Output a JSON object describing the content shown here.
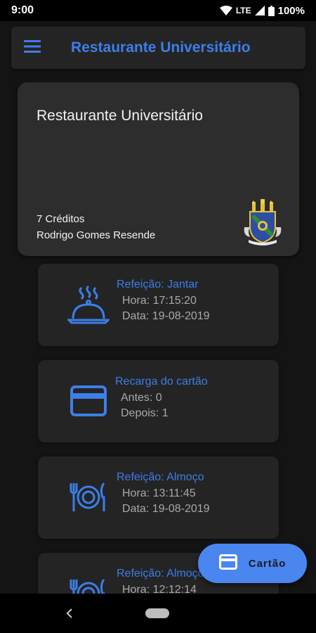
{
  "status": {
    "time": "9:00",
    "network": "LTE",
    "battery": "100%"
  },
  "appbar": {
    "title": "Restaurante Universitário",
    "menu_icon": "menu-icon"
  },
  "card": {
    "title": "Restaurante Universitário",
    "credits": "7 Créditos",
    "holder": "Rodrigo Gomes Resende",
    "crest_icon": "university-crest-icon"
  },
  "transactions": [
    {
      "icon": "cloche-icon",
      "title": "Refeição: Jantar",
      "line1": "Hora: 17:15:20",
      "line2": "Data: 19-08-2019"
    },
    {
      "icon": "credit-card-icon",
      "title": "Recarga do cartão",
      "line1": "Antes: 0",
      "line2": "Depois: 1"
    },
    {
      "icon": "plate-cutlery-icon",
      "title": "Refeição: Almoço",
      "line1": "Hora: 13:11:45",
      "line2": "Data: 19-08-2019"
    },
    {
      "icon": "plate-cutlery-icon",
      "title": "Refeição: Almoço",
      "line1": "Hora: 12:12:14",
      "line2": ""
    }
  ],
  "fab": {
    "label": "Cartão",
    "icon": "credit-card-icon"
  },
  "colors": {
    "accent": "#3d7ee8",
    "fab": "#4a86f0",
    "background": "#141414",
    "card": "#2d2d2d"
  }
}
